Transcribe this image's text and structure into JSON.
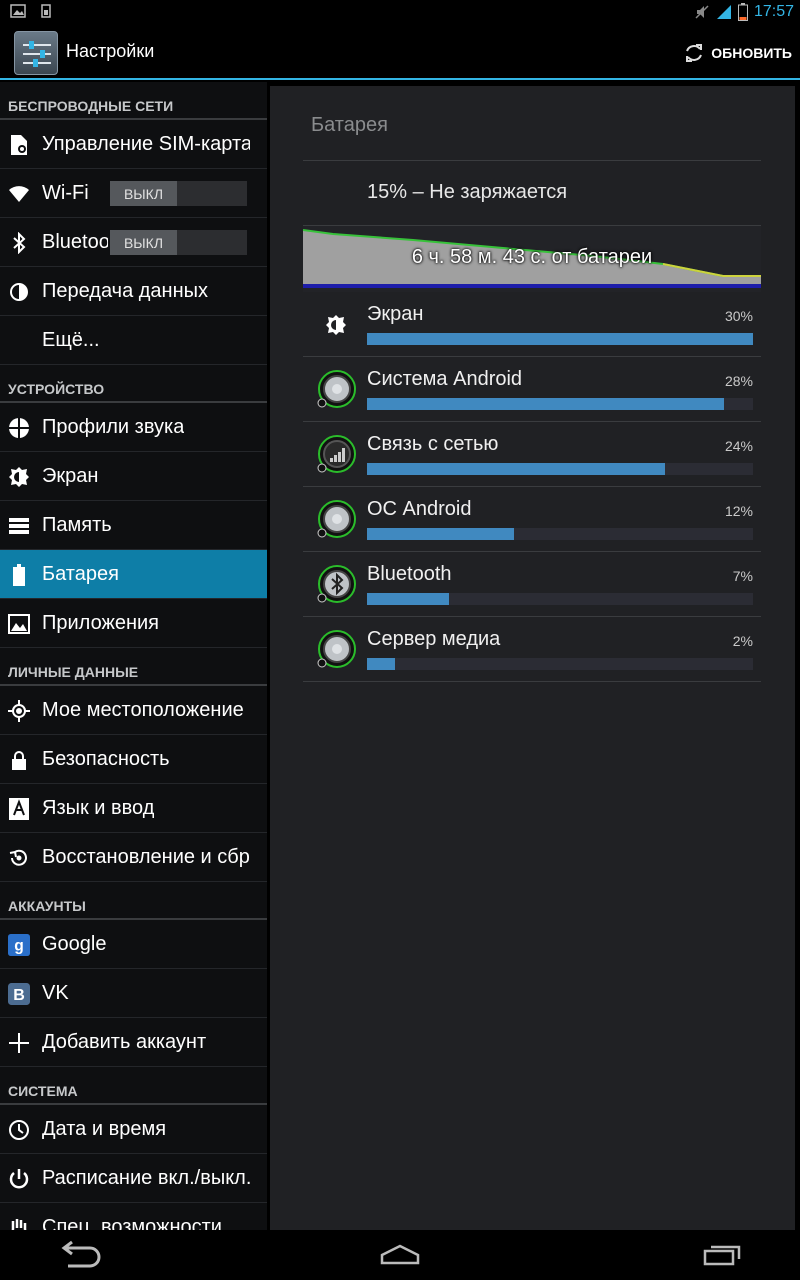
{
  "status_bar": {
    "time": "17:57"
  },
  "action_bar": {
    "title": "Настройки",
    "refresh_label": "ОБНОВИТЬ"
  },
  "sidebar": {
    "categories": {
      "wireless": "БЕСПРОВОДНЫЕ СЕТИ",
      "device": "УСТРОЙСТВО",
      "personal": "ЛИЧНЫЕ ДАННЫЕ",
      "accounts": "АККАУНТЫ",
      "system": "СИСТЕМА"
    },
    "items": {
      "sim": "Управление SIM-картами",
      "wifi": "Wi-Fi",
      "bluetooth": "Bluetooth",
      "data": "Передача данных",
      "more": "Ещё...",
      "sound": "Профили звука",
      "screen": "Экран",
      "memory": "Память",
      "battery": "Батарея",
      "apps": "Приложения",
      "location": "Мое местоположение",
      "security": "Безопасность",
      "language": "Язык и ввод",
      "backup": "Восстановление и сброс",
      "google": "Google",
      "vk": "VK",
      "add_account": "Добавить аккаунт",
      "datetime": "Дата и время",
      "schedule": "Расписание вкл./выкл. питания",
      "accessibility": "Спец. возможности"
    },
    "toggles": {
      "wifi": "ВЫКЛ",
      "bluetooth": "ВЫКЛ"
    }
  },
  "main": {
    "title": "Батарея",
    "status": "15% – Не заряжается",
    "graph_label": "6 ч. 58 м. 43 с. от батареи",
    "usage": [
      {
        "name": "Экран",
        "percent_label": "30%",
        "fraction": 1.0
      },
      {
        "name": "Система Android",
        "percent_label": "28%",
        "fraction": 0.924
      },
      {
        "name": "Связь с сетью",
        "percent_label": "24%",
        "fraction": 0.772
      },
      {
        "name": "ОС Android",
        "percent_label": "12%",
        "fraction": 0.381
      },
      {
        "name": "Bluetooth",
        "percent_label": "7%",
        "fraction": 0.212
      },
      {
        "name": "Сервер медиа",
        "percent_label": "2%",
        "fraction": 0.073
      }
    ]
  },
  "colors": {
    "accent": "#33b5e5",
    "selected": "#0e7ea7",
    "bar": "#4089c0",
    "graph_line": "#37c23a"
  }
}
